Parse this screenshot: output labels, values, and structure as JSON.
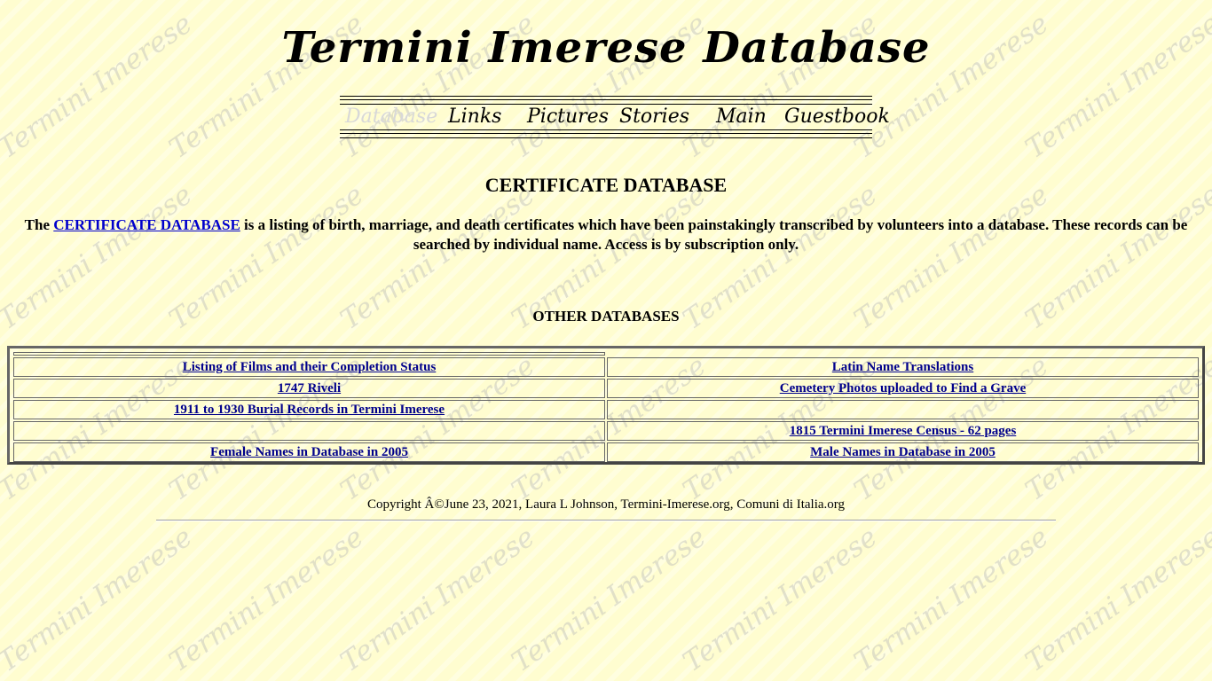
{
  "site": {
    "title": "Termini Imerese Database",
    "watermark": "Termini Imerese"
  },
  "nav": {
    "items": [
      {
        "label": "Database",
        "current": true
      },
      {
        "label": "Links",
        "current": false
      },
      {
        "label": "Pictures",
        "current": false
      },
      {
        "label": "Stories",
        "current": false
      },
      {
        "label": "Main",
        "current": false
      },
      {
        "label": "Guestbook",
        "current": false
      }
    ]
  },
  "main": {
    "heading": "CERTIFICATE DATABASE",
    "intro_before": "The ",
    "intro_link": "CERTIFICATE DATABASE",
    "intro_after": " is a listing of birth, marriage, and death certificates which have been painstakingly transcribed by volunteers into a database. These records can be searched by individual name. Access is by subscription only.",
    "other_heading": "OTHER DATABASES",
    "table": {
      "rows": [
        {
          "left": "Listing of Films and their Completion Status",
          "right": "Latin Name Translations"
        },
        {
          "left": "1747 Riveli",
          "right": "Cemetery Photos uploaded to Find a Grave"
        },
        {
          "left": "1911 to 1930 Burial Records in Termini Imerese",
          "right": ""
        },
        {
          "left": "",
          "right": "1815 Termini Imerese Census - 62 pages"
        },
        {
          "left": "Female Names in Database in 2005",
          "right": "Male Names in Database in 2005"
        }
      ]
    }
  },
  "footer": {
    "copyright": "Copyright Â©June 23, 2021, Laura L Johnson, Termini-Imerese.org, Comuni di Italia.org"
  }
}
